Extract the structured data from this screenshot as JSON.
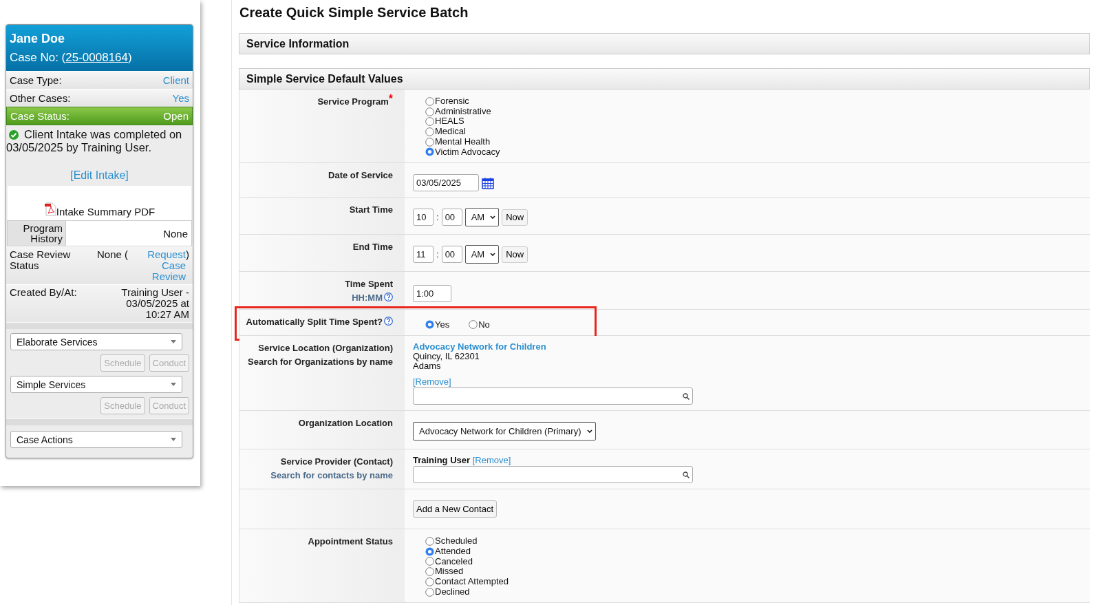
{
  "sidebar": {
    "name": "Jane Doe",
    "case_no_label": "Case No: (",
    "case_no": "25-0008164",
    "case_no_suffix": ")",
    "info_rows": [
      {
        "kind": "link",
        "label": "Case Type:",
        "value": "Client"
      },
      {
        "kind": "link",
        "label": "Other Cases:",
        "value": "Yes"
      },
      {
        "kind": "status",
        "label": "Case Status:",
        "value": "Open"
      }
    ],
    "intake_note": "Client Intake was completed on 03/05/2025 by Training User.",
    "edit_link": "[Edit Intake]",
    "pdf_link": "Intake Summary PDF",
    "program_history": {
      "label": "Program History",
      "value": "None"
    },
    "case_review": {
      "label": "Case Review Status",
      "value": "None (",
      "link": "Request Case Review",
      "suffix": ")"
    },
    "created": {
      "label": "Created By/At:",
      "value": "Training User - 03/05/2025 at 10:27 AM"
    },
    "action_groups": [
      {
        "select": "Elaborate Services",
        "buttons": [
          {
            "label": "Schedule",
            "disabled": true
          },
          {
            "label": "Conduct",
            "disabled": true
          }
        ]
      },
      {
        "select": "Simple Services",
        "buttons": [
          {
            "label": "Schedule",
            "disabled": true
          },
          {
            "label": "Conduct",
            "disabled": true
          }
        ]
      },
      {
        "select": "Case Actions"
      }
    ]
  },
  "page_title": "Create Quick Simple Service Batch",
  "sections": [
    {
      "title": "Service Information"
    },
    {
      "title": "Simple Service Default Values"
    }
  ],
  "form_rows": [
    {
      "kind": "radio-list",
      "label": "Service Program",
      "required_mark": "*",
      "options": [
        {
          "label": "Forensic",
          "selected": false
        },
        {
          "label": "Administrative",
          "selected": false
        },
        {
          "label": "HEALS",
          "selected": false
        },
        {
          "label": "Medical",
          "selected": false
        },
        {
          "label": "Mental Health",
          "selected": false
        },
        {
          "label": "Victim Advocacy",
          "selected": true
        }
      ]
    },
    {
      "kind": "date",
      "label": "Date of Service",
      "value": "03/05/2025"
    },
    {
      "kind": "time",
      "label": "Start Time",
      "hour": "10",
      "separator": ":",
      "minute": "00",
      "ampm": "AM",
      "button": "Now"
    },
    {
      "kind": "time",
      "label": "End Time",
      "hour": "11",
      "separator": ":",
      "minute": "00",
      "ampm": "AM",
      "button": "Now"
    },
    {
      "kind": "duration",
      "label": "Time Spent",
      "sublabel": {
        "text": "HH:MM",
        "color": "#4a6a8a"
      },
      "help": true,
      "value": "1:00"
    },
    {
      "kind": "radio-inline",
      "label": "Automatically Split Time Spent?",
      "help": true,
      "highlighted": true,
      "options": [
        {
          "label": "Yes",
          "selected": true
        },
        {
          "label": "No",
          "selected": false
        }
      ]
    },
    {
      "kind": "organization",
      "label": "Service Location (Organization)",
      "sublabel": {
        "text": "Search for Organizations by name",
        "color": "#222222"
      },
      "name": "Advocacy Network for Children",
      "address": [
        "Quincy, IL 62301",
        "Adams"
      ],
      "remove": "[Remove]"
    },
    {
      "kind": "select",
      "label": "Organization Location",
      "value": "Advocacy Network for Children (Primary)"
    },
    {
      "kind": "contact",
      "label": "Service Provider (Contact)",
      "sublabel": {
        "text": "Search for contacts by name",
        "color": "#4a6a8a"
      },
      "name": "Training User",
      "remove": "[Remove]"
    },
    {
      "kind": "button",
      "value": "Add a New Contact"
    },
    {
      "kind": "radio-list",
      "label": "Appointment Status",
      "options": [
        {
          "label": "Scheduled",
          "selected": false
        },
        {
          "label": "Attended",
          "selected": true
        },
        {
          "label": "Canceled",
          "selected": false
        },
        {
          "label": "Missed",
          "selected": false
        },
        {
          "label": "Contact Attempted",
          "selected": false
        },
        {
          "label": "Declined",
          "selected": false
        }
      ]
    }
  ]
}
